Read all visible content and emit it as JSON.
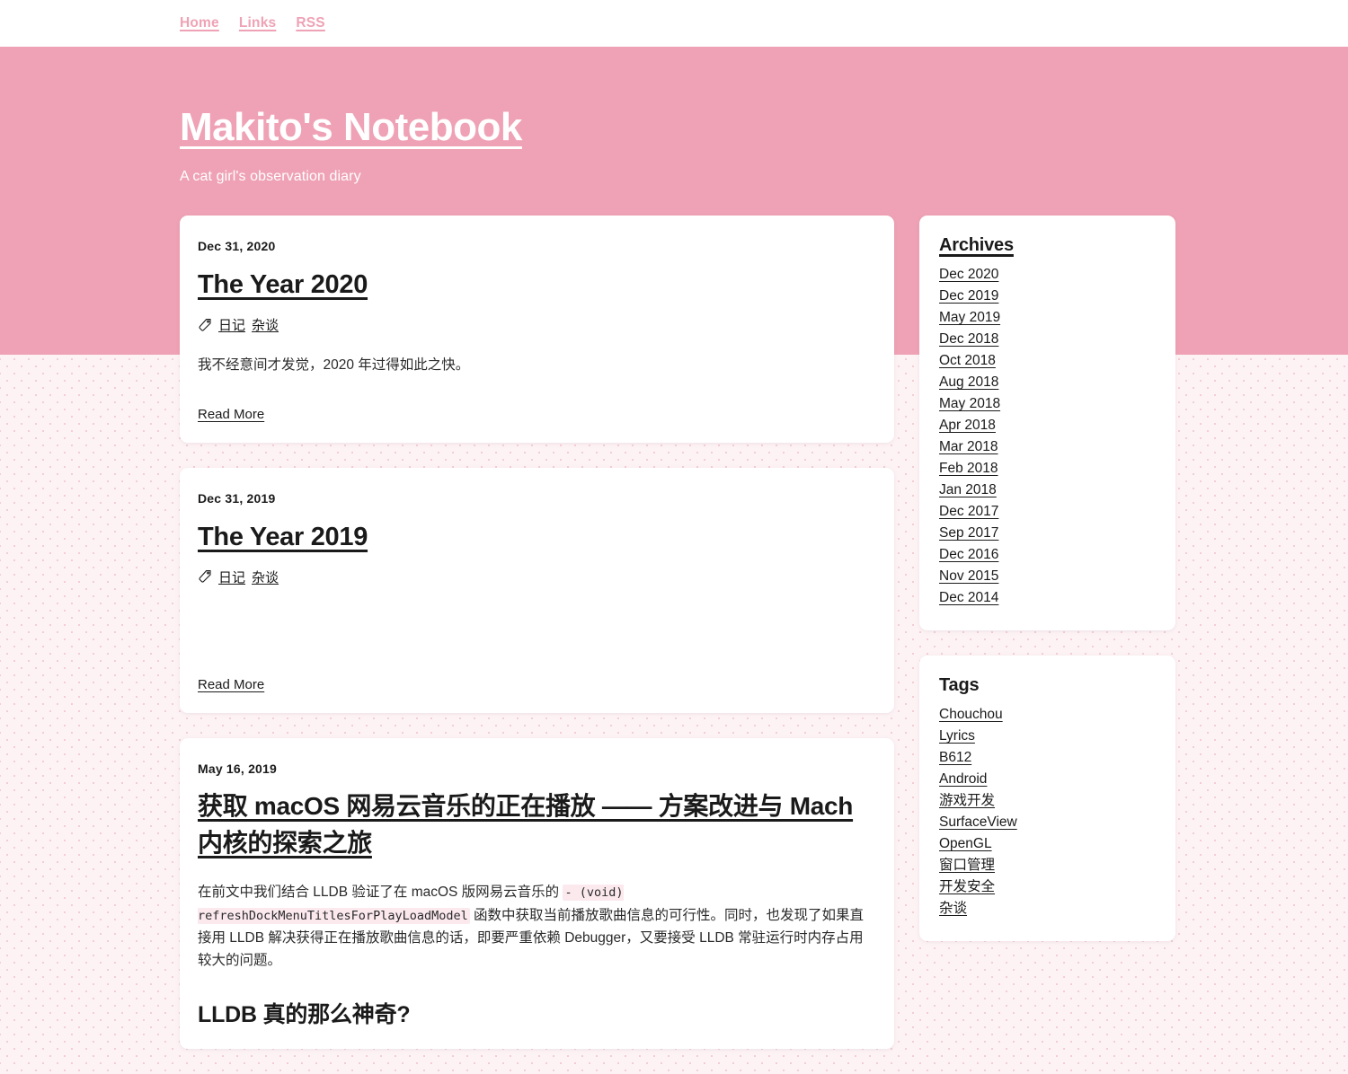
{
  "nav": {
    "links": [
      {
        "label": "Home"
      },
      {
        "label": "Links"
      },
      {
        "label": "RSS"
      }
    ]
  },
  "header": {
    "title": "Makito's Notebook",
    "tagline": "A cat girl's observation diary",
    "background_color": "#efa2b5",
    "text_color": "#ffffff"
  },
  "posts": [
    {
      "date": "Dec 31, 2020",
      "title": "The Year 2020",
      "tag_icon": "tag-icon",
      "tags": [
        "日记",
        "杂谈"
      ],
      "excerpt": "我不经意间才发觉，2020 年过得如此之快。",
      "read_more": "Read More"
    },
    {
      "date": "Dec 31, 2019",
      "title": "The Year 2019",
      "tag_icon": "tag-icon",
      "tags": [
        "日记",
        "杂谈"
      ],
      "excerpt": "",
      "read_more": "Read More"
    },
    {
      "date": "May 16, 2019",
      "title": "获取 macOS 网易云音乐的正在播放 —— 方案改进与 Mach 内核的探索之旅",
      "excerpt_part_1": "在前文中我们结合 LLDB 验证了在 macOS 版网易云音乐的 ",
      "excerpt_code": "- (void) refreshDockMenuTitlesForPlayLoadModel",
      "excerpt_part_2": " 函数中获取当前播放歌曲信息的可行性。同时，也发现了如果直接用 LLDB 解决获得正在播放歌曲信息的话，即要严重依赖 Debugger，又要接受 LLDB 常驻运行时内存占用较大的问题。",
      "sub_heading": "LLDB 真的那么神奇?"
    }
  ],
  "sidebar": {
    "archives": {
      "title": "Archives",
      "items": [
        {
          "label": "Dec 2020"
        },
        {
          "label": "Dec 2019"
        },
        {
          "label": "May 2019"
        },
        {
          "label": "Dec 2018"
        },
        {
          "label": "Oct 2018"
        },
        {
          "label": "Aug 2018"
        },
        {
          "label": "May 2018"
        },
        {
          "label": "Apr 2018"
        },
        {
          "label": "Mar 2018"
        },
        {
          "label": "Feb 2018"
        },
        {
          "label": "Jan 2018"
        },
        {
          "label": "Dec 2017"
        },
        {
          "label": "Sep 2017"
        },
        {
          "label": "Dec 2016"
        },
        {
          "label": "Nov 2015"
        },
        {
          "label": "Dec 2014"
        }
      ]
    },
    "tags": {
      "title": "Tags",
      "items": [
        {
          "label": "Chouchou"
        },
        {
          "label": "Lyrics"
        },
        {
          "label": "B612"
        },
        {
          "label": "Android"
        },
        {
          "label": "游戏开发"
        },
        {
          "label": "SurfaceView"
        },
        {
          "label": "OpenGL"
        },
        {
          "label": "窗口管理"
        },
        {
          "label": "开发安全"
        },
        {
          "label": "杂谈"
        }
      ]
    }
  }
}
